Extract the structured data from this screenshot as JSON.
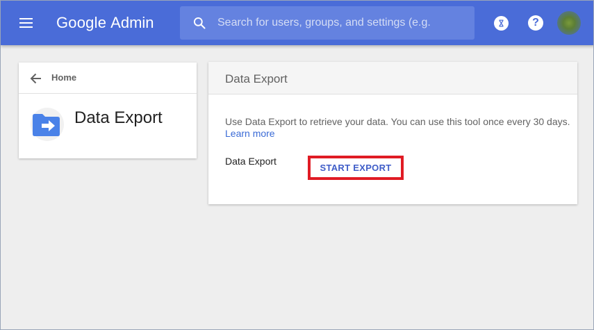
{
  "topbar": {
    "menu_icon": "hamburger-menu-icon",
    "logo_google": "Google",
    "logo_admin": "Admin",
    "search_placeholder": "Search for users, groups, and settings (e.g.",
    "search_icon": "search-icon",
    "hourglass_icon": "hourglass-icon",
    "help_label": "?",
    "accent_color": "#4a6cd8"
  },
  "left_card": {
    "back_label": "Home",
    "back_icon": "arrow-left-icon",
    "app_icon": "folder-export-icon",
    "title": "Data Export"
  },
  "right_card": {
    "header_title": "Data Export",
    "description": "Use Data Export to retrieve your data. You can use this tool once every 30 days.",
    "learn_more": "Learn more",
    "field_label": "Data Export",
    "start_export_label": "START EXPORT",
    "highlight_color": "#e01b24"
  }
}
